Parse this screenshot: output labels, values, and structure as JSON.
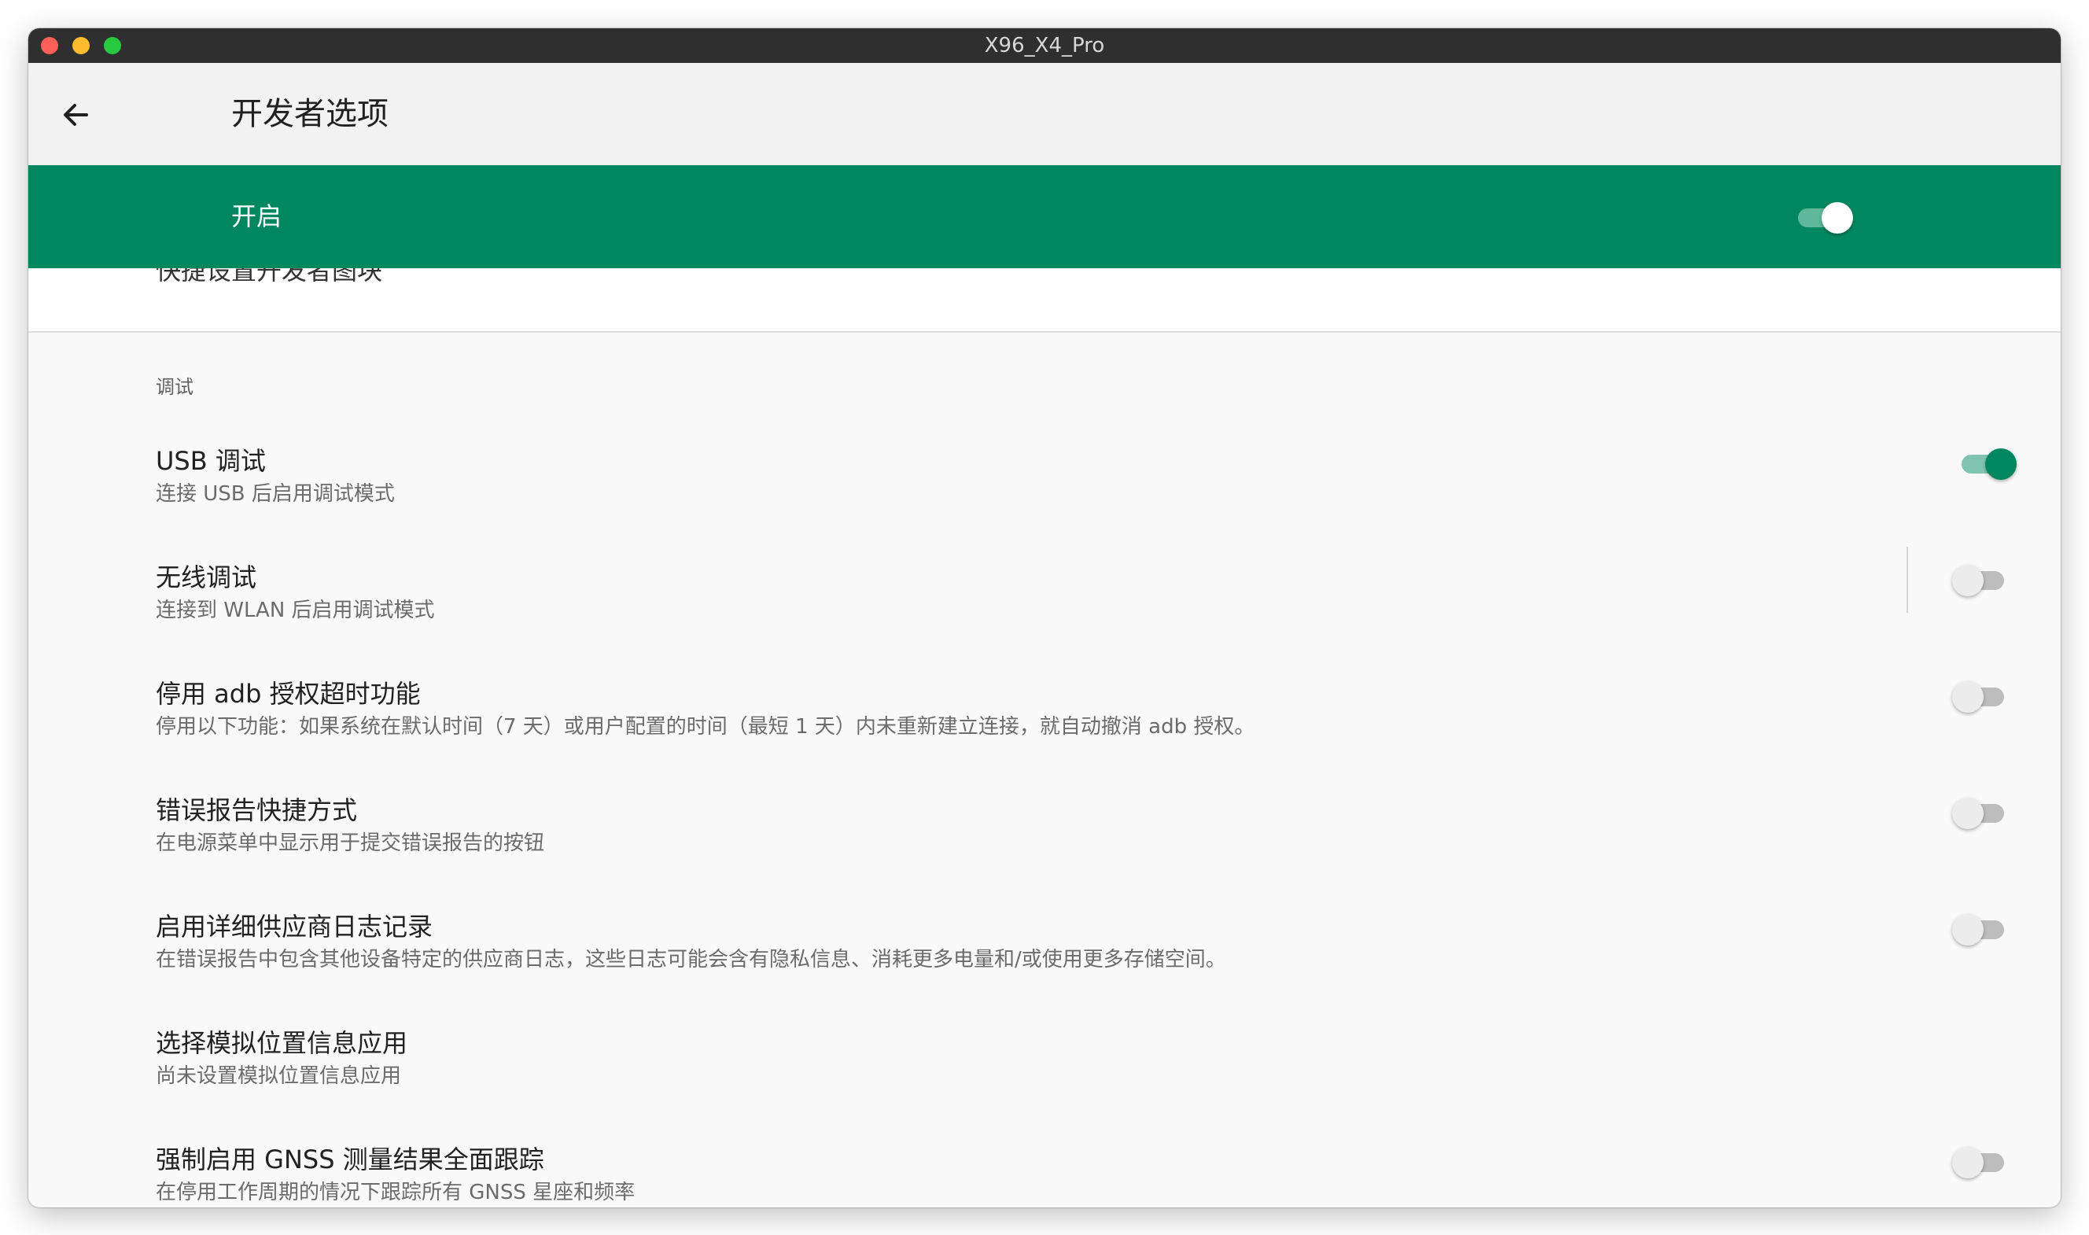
{
  "window": {
    "title": "X96_X4_Pro"
  },
  "appbar": {
    "title": "开发者选项",
    "back_icon": "arrow-left-icon"
  },
  "master_switch": {
    "label": "开启",
    "on": true
  },
  "peek_text": "快捷设置开发者图块",
  "section": {
    "header": "调试"
  },
  "items": [
    {
      "title": "USB 调试",
      "subtitle": "连接 USB 后启用调试模式",
      "switch": "on"
    },
    {
      "title": "无线调试",
      "subtitle": "连接到 WLAN 后启用调试模式",
      "switch": "off"
    },
    {
      "title": "停用 adb 授权超时功能",
      "subtitle": "停用以下功能：如果系统在默认时间（7 天）或用户配置的时间（最短 1 天）内未重新建立连接，就自动撤消 adb 授权。",
      "switch": "off"
    },
    {
      "title": "错误报告快捷方式",
      "subtitle": "在电源菜单中显示用于提交错误报告的按钮",
      "switch": "off"
    },
    {
      "title": "启用详细供应商日志记录",
      "subtitle": "在错误报告中包含其他设备特定的供应商日志，这些日志可能会含有隐私信息、消耗更多电量和/或使用更多存储空间。",
      "switch": "off"
    },
    {
      "title": "选择模拟位置信息应用",
      "subtitle": "尚未设置模拟位置信息应用",
      "switch": "none"
    },
    {
      "title": "强制启用 GNSS 测量结果全面跟踪",
      "subtitle": "在停用工作周期的情况下跟踪所有 GNSS 星座和频率",
      "switch": "off"
    }
  ],
  "colors": {
    "accent": "#00875f",
    "titlebar": "#2f2f2f"
  }
}
